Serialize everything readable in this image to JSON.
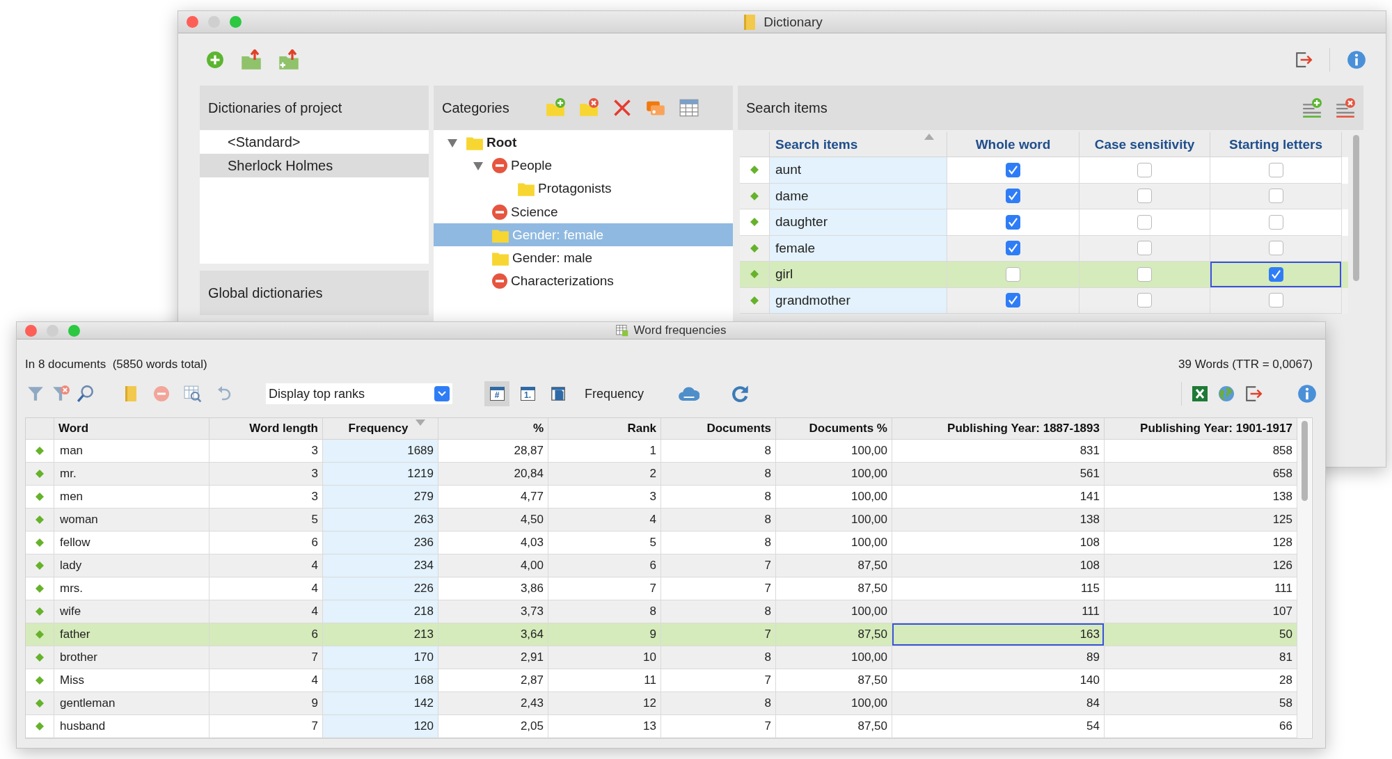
{
  "dictionary_window": {
    "title": "Dictionary",
    "dictionaries_panel": {
      "header": "Dictionaries of project",
      "items": [
        {
          "label": "<Standard>",
          "selected": false
        },
        {
          "label": "Sherlock Holmes",
          "selected": true
        }
      ],
      "global_header": "Global dictionaries"
    },
    "categories_panel": {
      "header": "Categories",
      "tree": [
        {
          "label": "Root",
          "kind": "folder",
          "expanded": true,
          "selected": false,
          "children": [
            {
              "label": "People",
              "kind": "blocked",
              "expanded": true,
              "selected": false,
              "children": [
                {
                  "label": "Protagonists",
                  "kind": "folder",
                  "selected": false
                }
              ]
            },
            {
              "label": "Science",
              "kind": "blocked",
              "selected": false
            },
            {
              "label": "Gender: female",
              "kind": "folder",
              "selected": true
            },
            {
              "label": "Gender: male",
              "kind": "folder",
              "selected": false
            },
            {
              "label": "Characterizations",
              "kind": "blocked",
              "selected": false
            }
          ]
        }
      ]
    },
    "search_panel": {
      "header": "Search items",
      "columns": [
        {
          "label": "Search items",
          "sorted": true,
          "descending": false,
          "focused": false
        },
        {
          "label": "Whole word",
          "sorted": false,
          "focused": false
        },
        {
          "label": "Case sensitivity",
          "sorted": false,
          "focused": false
        },
        {
          "label": "Starting letters",
          "sorted": false,
          "focused": true
        }
      ],
      "rows": [
        {
          "item": "aunt",
          "whole_word": true,
          "case_sensitivity": false,
          "starting_letters": false,
          "selected": false
        },
        {
          "item": "dame",
          "whole_word": true,
          "case_sensitivity": false,
          "starting_letters": false,
          "selected": false
        },
        {
          "item": "daughter",
          "whole_word": true,
          "case_sensitivity": false,
          "starting_letters": false,
          "selected": false
        },
        {
          "item": "female",
          "whole_word": true,
          "case_sensitivity": false,
          "starting_letters": false,
          "selected": false
        },
        {
          "item": "girl",
          "whole_word": false,
          "case_sensitivity": false,
          "starting_letters": true,
          "selected": true
        },
        {
          "item": "grandmother",
          "whole_word": true,
          "case_sensitivity": false,
          "starting_letters": false,
          "selected": false
        }
      ]
    }
  },
  "word_frequencies_window": {
    "title": "Word frequencies",
    "summary": "In 8 documents  (5850 words total)",
    "word_count": "39 Words (TTR = 0,0067)",
    "rank_filter": {
      "value": "Display top ranks"
    },
    "view_buttons": [
      {
        "kind": "hash",
        "label": "#",
        "selected": true
      },
      {
        "kind": "rank",
        "label": "1.",
        "selected": false
      },
      {
        "kind": "page",
        "selected": false
      }
    ],
    "view_label": "Frequency",
    "columns": [
      {
        "label": "Word",
        "sorted": false,
        "focused": false
      },
      {
        "label": "Word length",
        "sorted": false,
        "focused": false
      },
      {
        "label": "Frequency",
        "sorted": true,
        "descending": true,
        "focused": false
      },
      {
        "label": "%",
        "sorted": false,
        "focused": false
      },
      {
        "label": "Rank",
        "sorted": false,
        "focused": false
      },
      {
        "label": "Documents",
        "sorted": false,
        "focused": false
      },
      {
        "label": "Documents %",
        "sorted": false,
        "focused": false
      },
      {
        "label": "Publishing Year: 1887-1893",
        "sorted": false,
        "focused": true
      },
      {
        "label": "Publishing Year: 1901-1917",
        "sorted": false,
        "focused": false
      }
    ],
    "rows": [
      {
        "cells": [
          "man",
          "3",
          "1689",
          "28,87",
          "1",
          "8",
          "100,00",
          "831",
          "858"
        ],
        "selected": false
      },
      {
        "cells": [
          "mr.",
          "3",
          "1219",
          "20,84",
          "2",
          "8",
          "100,00",
          "561",
          "658"
        ],
        "selected": false
      },
      {
        "cells": [
          "men",
          "3",
          "279",
          "4,77",
          "3",
          "8",
          "100,00",
          "141",
          "138"
        ],
        "selected": false
      },
      {
        "cells": [
          "woman",
          "5",
          "263",
          "4,50",
          "4",
          "8",
          "100,00",
          "138",
          "125"
        ],
        "selected": false
      },
      {
        "cells": [
          "fellow",
          "6",
          "236",
          "4,03",
          "5",
          "8",
          "100,00",
          "108",
          "128"
        ],
        "selected": false
      },
      {
        "cells": [
          "lady",
          "4",
          "234",
          "4,00",
          "6",
          "7",
          "87,50",
          "108",
          "126"
        ],
        "selected": false
      },
      {
        "cells": [
          "mrs.",
          "4",
          "226",
          "3,86",
          "7",
          "7",
          "87,50",
          "115",
          "111"
        ],
        "selected": false
      },
      {
        "cells": [
          "wife",
          "4",
          "218",
          "3,73",
          "8",
          "8",
          "100,00",
          "111",
          "107"
        ],
        "selected": false
      },
      {
        "cells": [
          "father",
          "6",
          "213",
          "3,64",
          "9",
          "7",
          "87,50",
          "163",
          "50"
        ],
        "selected": true
      },
      {
        "cells": [
          "brother",
          "7",
          "170",
          "2,91",
          "10",
          "8",
          "100,00",
          "89",
          "81"
        ],
        "selected": false
      },
      {
        "cells": [
          "Miss",
          "4",
          "168",
          "2,87",
          "11",
          "7",
          "87,50",
          "140",
          "28"
        ],
        "selected": false
      },
      {
        "cells": [
          "gentleman",
          "9",
          "142",
          "2,43",
          "12",
          "8",
          "100,00",
          "84",
          "58"
        ],
        "selected": false
      },
      {
        "cells": [
          "husband",
          "7",
          "120",
          "2,05",
          "13",
          "7",
          "87,50",
          "54",
          "66"
        ],
        "selected": false
      }
    ]
  }
}
